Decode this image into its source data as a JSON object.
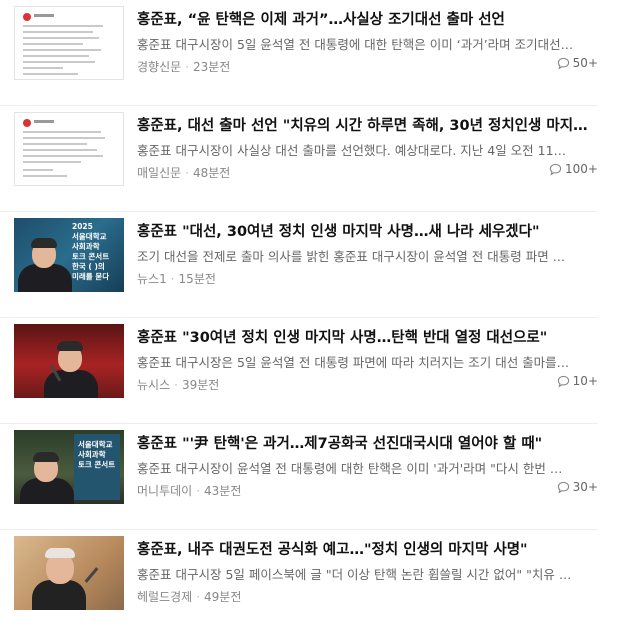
{
  "articles": [
    {
      "title": "홍준표, “윤 탄핵은 이제 과거”…사실상 조기대선 출마 선언",
      "snippet": "홍준표 대구시장이 5일 윤석열 전 대통령에 대한 탄핵은 이미 ‘과거’라며 조기대선…",
      "source": "경향신문",
      "time": "23분전",
      "comments": "50+"
    },
    {
      "title": "홍준표, 대선 출마 선언 \"치유의 시간 하루면 족해, 30년 정치인생 마지막…",
      "snippet": "홍준표 대구시장이 사실상 대선 출마를 선언했다. 예상대로다. 지난 4일 오전 11…",
      "source": "매일신문",
      "time": "48분전",
      "comments": "100+"
    },
    {
      "title": "홍준표 \"대선, 30여년 정치 인생 마지막 사명…새 나라 세우겠다\"",
      "snippet": "조기 대선을 전제로 출마 의사를 밝힌 홍준표 대구시장이 윤석열 전 대통령 파면 …",
      "source": "뉴스1",
      "time": "15분전",
      "comments": ""
    },
    {
      "title": "홍준표 \"30여년 정치 인생 마지막 사명…탄핵 반대 열정 대선으로\"",
      "snippet": "홍준표 대구시장은 5일 윤석열 전 대통령 파면에 따라 치러지는 조기 대선 출마를…",
      "source": "뉴시스",
      "time": "39분전",
      "comments": "10+"
    },
    {
      "title": "홍준표 \"'尹 탄핵'은 과거…제7공화국 선진대국시대 열어야 할 때\"",
      "snippet": "홍준표 대구시장이 윤석열 전 대통령에 대한 탄핵은 이미 '과거'라며 \"다시 한번 …",
      "source": "머니투데이",
      "time": "43분전",
      "comments": "30+"
    },
    {
      "title": "홍준표, 내주 대권도전 공식화 예고…\"정치 인생의 마지막 사명\"",
      "snippet": "홍준표 대구시장 5일 페이스북에 글 \"더 이상 탄핵 논란 휩쓸릴 시간 없어\" \"치유 …",
      "source": "헤럴드경제",
      "time": "49분전",
      "comments": ""
    }
  ],
  "thumbnails": {
    "poster_text_3": "2025\n서울대학교\n사회과학\n토크 콘서트\n한국 ( )의\n미래를 묻다",
    "poster_text_5": "서울대학교\n사회과학\n토크 콘서트"
  }
}
